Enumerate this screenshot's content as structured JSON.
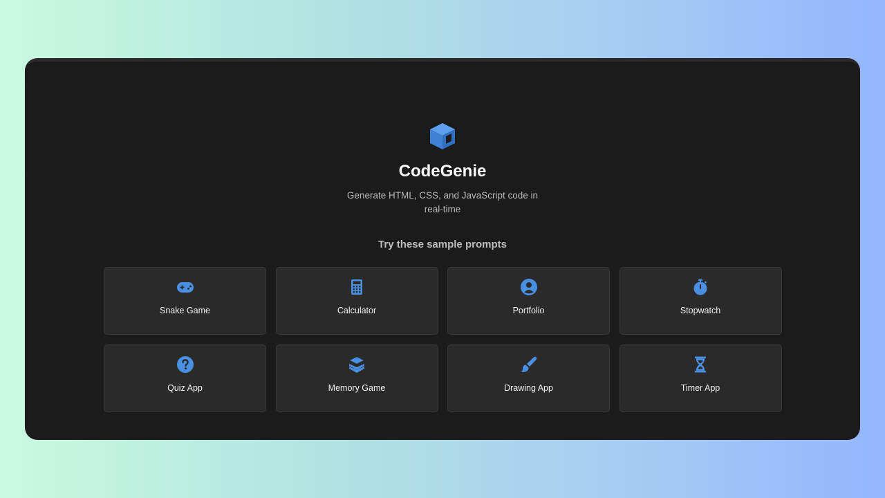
{
  "app": {
    "title": "CodeGenie",
    "subtitle": "Generate HTML, CSS, and JavaScript code in real-time",
    "logo_icon": "cube-icon",
    "accent_color": "#4a90e2"
  },
  "prompts": {
    "heading": "Try these sample prompts",
    "items": [
      {
        "label": "Snake Game",
        "icon": "gamepad-icon"
      },
      {
        "label": "Calculator",
        "icon": "calculator-icon"
      },
      {
        "label": "Portfolio",
        "icon": "user-circle-icon"
      },
      {
        "label": "Stopwatch",
        "icon": "stopwatch-icon"
      },
      {
        "label": "Quiz App",
        "icon": "question-circle-icon"
      },
      {
        "label": "Memory Game",
        "icon": "layers-icon"
      },
      {
        "label": "Drawing App",
        "icon": "paint-brush-icon"
      },
      {
        "label": "Timer App",
        "icon": "hourglass-icon"
      }
    ]
  }
}
